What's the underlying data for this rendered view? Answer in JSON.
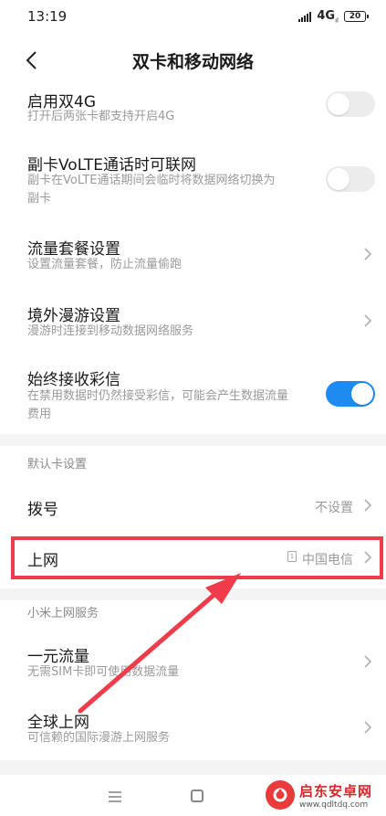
{
  "status_bar": {
    "time": "13:19",
    "network": "4G",
    "network_sub": "ıl",
    "battery": "20"
  },
  "header": {
    "title": "双卡和移动网络"
  },
  "settings": {
    "dual_4g": {
      "title": "启用双4G",
      "desc": "打开后两张卡都支持开启4G",
      "enabled": false
    },
    "volte": {
      "title": "副卡VoLTE通话时可联网",
      "desc_line1": "副卡在VoLTE通话期间会临时将数据网络切换为",
      "desc_line2": "副卡",
      "enabled": false
    },
    "data_plan": {
      "title": "流量套餐设置",
      "desc": "设置流量套餐，防止流量偷跑"
    },
    "roaming": {
      "title": "境外漫游设置",
      "desc": "漫游时连接到移动数据网络服务"
    },
    "mms": {
      "title": "始终接收彩信",
      "desc_line1": "在禁用数据时仍然接受彩信，可能会产生数据流量",
      "desc_line2": "费用",
      "enabled": true
    }
  },
  "default_card": {
    "section_title": "默认卡设置",
    "dial": {
      "title": "拨号",
      "value": "不设置"
    },
    "internet": {
      "title": "上网",
      "sim_slot": "1",
      "value": "中国电信"
    }
  },
  "xiaomi_services": {
    "section_title": "小米上网服务",
    "one_yuan": {
      "title": "一元流量",
      "desc": "无需SIM卡即可使用数据流量"
    },
    "global": {
      "title": "全球上网",
      "desc": "可信赖的国际漫游上网服务"
    }
  },
  "watermark": {
    "title": "启东安卓网",
    "url": "www.qdltdq.com"
  },
  "colors": {
    "accent": "#1e8bf0",
    "highlight": "#f03b4b"
  }
}
